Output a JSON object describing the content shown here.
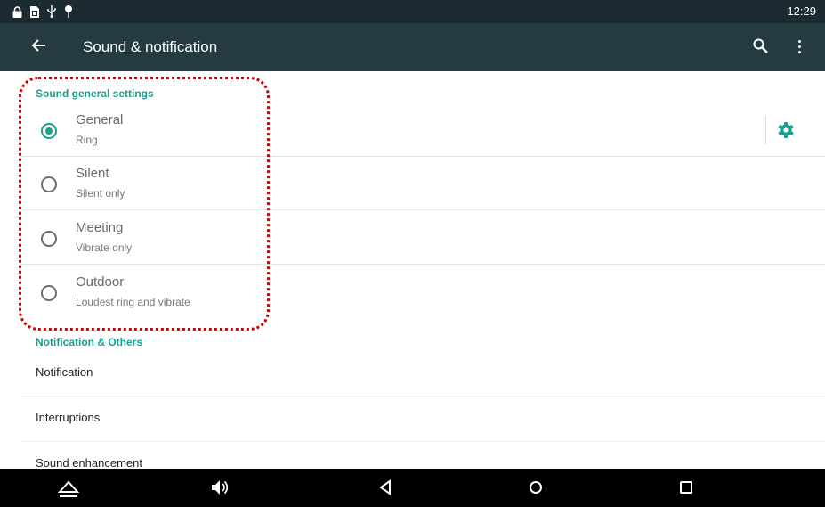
{
  "status_bar": {
    "time": "12:29",
    "icons": [
      "lock-icon",
      "sim-card-icon",
      "usb-icon",
      "location-pin-icon"
    ]
  },
  "toolbar": {
    "title": "Sound & notification",
    "back_icon": "arrow-left-icon",
    "search_icon": "search-icon",
    "more_icon": "more-vertical-icon"
  },
  "sound_section": {
    "header": "Sound general settings",
    "options": [
      {
        "title": "General",
        "subtitle": "Ring",
        "selected": true
      },
      {
        "title": "Silent",
        "subtitle": "Silent only",
        "selected": false
      },
      {
        "title": "Meeting",
        "subtitle": "Vibrate only",
        "selected": false
      },
      {
        "title": "Outdoor",
        "subtitle": "Loudest ring and vibrate",
        "selected": false
      }
    ],
    "settings_icon": "gear-icon"
  },
  "notification_section": {
    "header": "Notification & Others",
    "items": [
      "Notification",
      "Interruptions",
      "Sound enhancement"
    ]
  },
  "nav_bar": {
    "icons": [
      "eject-icon",
      "volume-icon",
      "back-triangle-icon",
      "home-circle-icon",
      "recents-square-icon"
    ]
  },
  "colors": {
    "accent": "#1a9e8e",
    "toolbar": "#263a41",
    "status_bar": "#1c2b31",
    "annotation": "#d60000"
  }
}
